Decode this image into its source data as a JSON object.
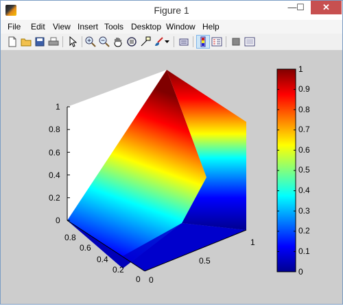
{
  "window": {
    "title": "Figure 1",
    "minimize_glyph": "—",
    "maximize_glyph": "☐",
    "close_glyph": "✕"
  },
  "menu": [
    {
      "label": "File"
    },
    {
      "label": "Edit"
    },
    {
      "label": "View"
    },
    {
      "label": "Insert"
    },
    {
      "label": "Tools"
    },
    {
      "label": "Desktop"
    },
    {
      "label": "Window"
    },
    {
      "label": "Help"
    }
  ],
  "toolbar": {
    "icons": [
      "new-figure-icon",
      "open-file-icon",
      "save-icon",
      "print-icon",
      "edit-plot-arrow-icon",
      "zoom-in-icon",
      "zoom-out-icon",
      "pan-hand-icon",
      "rotate-3d-icon",
      "data-cursor-icon",
      "brush-icon",
      "brush-dropdown-icon",
      "link-plot-icon",
      "insert-colorbar-icon",
      "insert-legend-icon",
      "hide-plot-tools-icon",
      "show-plot-tools-icon"
    ]
  },
  "chart_data": {
    "type": "surface",
    "colormap": "jet",
    "z_tick_labels": [
      "0",
      "0.2",
      "0.4",
      "0.6",
      "0.8",
      "1"
    ],
    "y_tick_labels": [
      "0",
      "0.2",
      "0.4",
      "0.6",
      "0.8"
    ],
    "x_tick_labels": [
      "0",
      "0.5",
      "1"
    ],
    "colorbar": {
      "min": 0,
      "max": 1,
      "tick_labels": [
        "0",
        "0.1",
        "0.2",
        "0.3",
        "0.4",
        "0.5",
        "0.6",
        "0.7",
        "0.8",
        "0.9",
        "1"
      ]
    },
    "grid": false,
    "title": "",
    "xlabel": "",
    "ylabel": "",
    "zlabel": ""
  }
}
